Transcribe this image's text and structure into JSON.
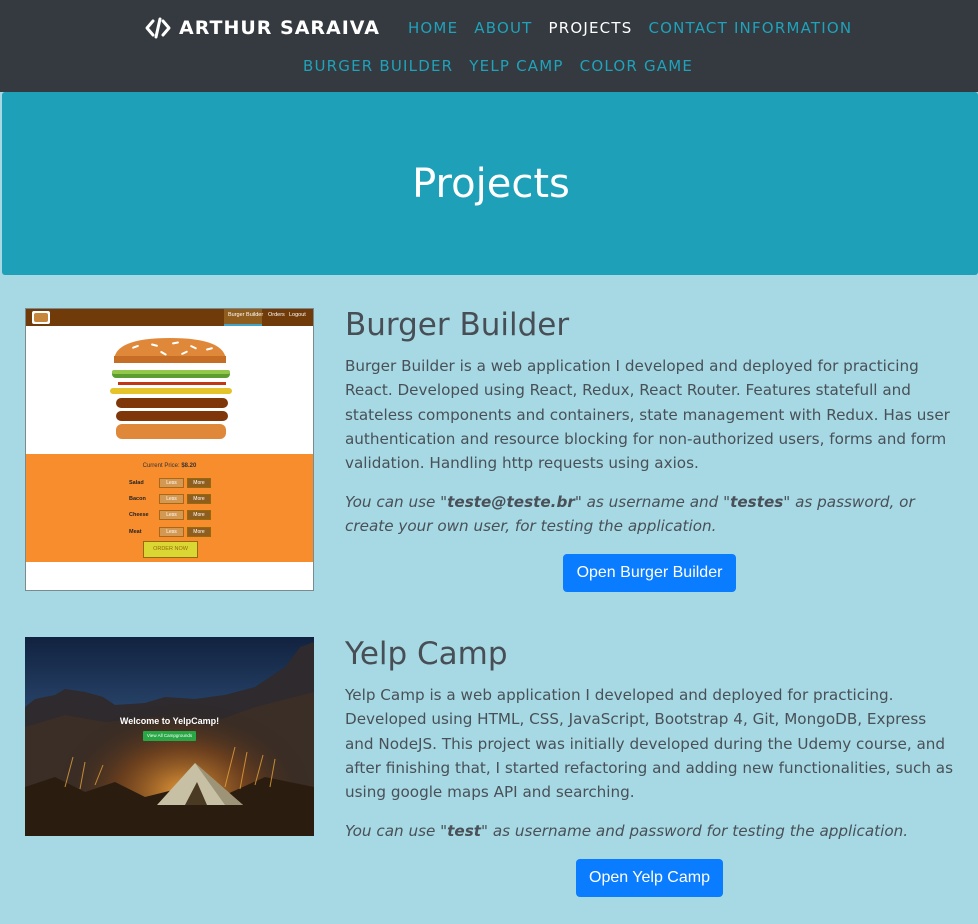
{
  "nav": {
    "brand": "ARTHUR SARAIVA",
    "links": [
      "HOME",
      "ABOUT",
      "PROJECTS",
      "CONTACT INFORMATION"
    ],
    "sublinks": [
      "BURGER BUILDER",
      "YELP CAMP",
      "COLOR GAME"
    ],
    "active": "PROJECTS"
  },
  "hero": {
    "title": "Projects"
  },
  "projects": [
    {
      "title": "Burger Builder",
      "description": "Burger Builder is a web application I developed and deployed for practicing React. Developed using React, Redux, React Router. Features statefull and stateless components and containers, state management with Redux. Has user authentication and resource blocking for non-authorized users, forms and form validation. Handling http requests using axios.",
      "note_pre": "You can use \"",
      "note_user": "teste@teste.br",
      "note_mid": "\" as username and \"",
      "note_pass": "testes",
      "note_post": "\" as password, or create your own user, for testing the application.",
      "button": "Open Burger Builder",
      "thumb": {
        "nav": [
          "Burger Builder",
          "Orders",
          "Logout"
        ],
        "price_label": "Current Price:",
        "price_value": "$8.20",
        "controls": [
          "Salad",
          "Bacon",
          "Cheese",
          "Meat"
        ],
        "less": "Less",
        "more": "More",
        "order": "ORDER NOW"
      }
    },
    {
      "title": "Yelp Camp",
      "description": "Yelp Camp is a web application I developed and deployed for practicing. Developed using HTML, CSS, JavaScript, Bootstrap 4, Git, MongoDB, Express and NodeJS. This project was initially developed during the Udemy course, and after finishing that, I started refactoring and adding new functionalities, such as using google maps API and searching.",
      "note_pre": "You can use \"",
      "note_user": "test",
      "note_post": "\" as username and password for testing the application.",
      "button": "Open Yelp Camp",
      "thumb": {
        "welcome": "Welcome to YelpCamp!",
        "button": "View All Campgrounds"
      }
    }
  ],
  "colors": {
    "navbar": "#343a40",
    "nav_link": "#1fa2ba",
    "hero": "#1ea0b8",
    "page_bg": "#a6d9e4",
    "button": "#0a7cff"
  }
}
